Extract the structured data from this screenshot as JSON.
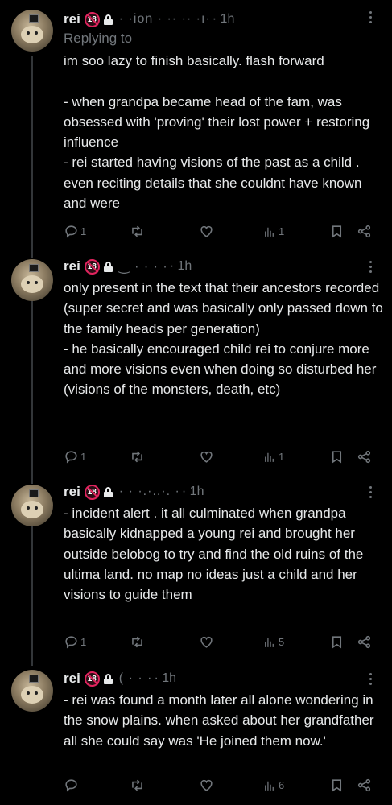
{
  "posts": [
    {
      "name": "rei",
      "badge": "18",
      "handle": "· ·ion · ·· ·· ·ı·",
      "time": "· 1h",
      "replying": "Replying to",
      "text": "im soo lazy to finish basically. flash forward\n\n- when grandpa became head of the fam, was obsessed with 'proving' their lost power + restoring influence\n- rei started having visions of the past as a child . even reciting details that she couldnt have known and were",
      "replies": "1",
      "views": "1"
    },
    {
      "name": "rei",
      "badge": "18",
      "handle": "‿ · · · ·",
      "time": "· 1h",
      "text": "only present in the text that their ancestors recorded (super secret and was basically only passed down to the family heads per generation)\n- he basically encouraged child rei to conjure more and more visions even when doing so disturbed her (visions of the monsters, death, etc)",
      "replies": "1",
      "views": "1"
    },
    {
      "name": "rei",
      "badge": "18",
      "handle": "· · ·.·..·. ·",
      "time": "· 1h",
      "text": "- incident alert . it all culminated when grandpa basically kidnapped a young rei and brought her outside belobog to try and find the old ruins of the ultima land. no map no ideas just a child and her visions to guide them",
      "replies": "1",
      "views": "5"
    },
    {
      "name": "rei",
      "badge": "18",
      "handle": "( · · ·",
      "time": "· 1h",
      "text": "- rei was found a month later all alone wondering in the snow plains. when asked about her grandfather all she could say was 'He joined them now.'",
      "replies": "",
      "views": "6"
    }
  ],
  "icons": {
    "reply": "reply-icon",
    "retweet": "retweet-icon",
    "like": "heart-icon",
    "views": "views-icon",
    "bookmark": "bookmark-icon",
    "share": "share-icon",
    "more": "more-icon"
  },
  "colors": {
    "background": "#000000",
    "text": "#e7e9ea",
    "muted": "#71767b",
    "badge": "#e0245e",
    "thread_line": "#333639"
  }
}
